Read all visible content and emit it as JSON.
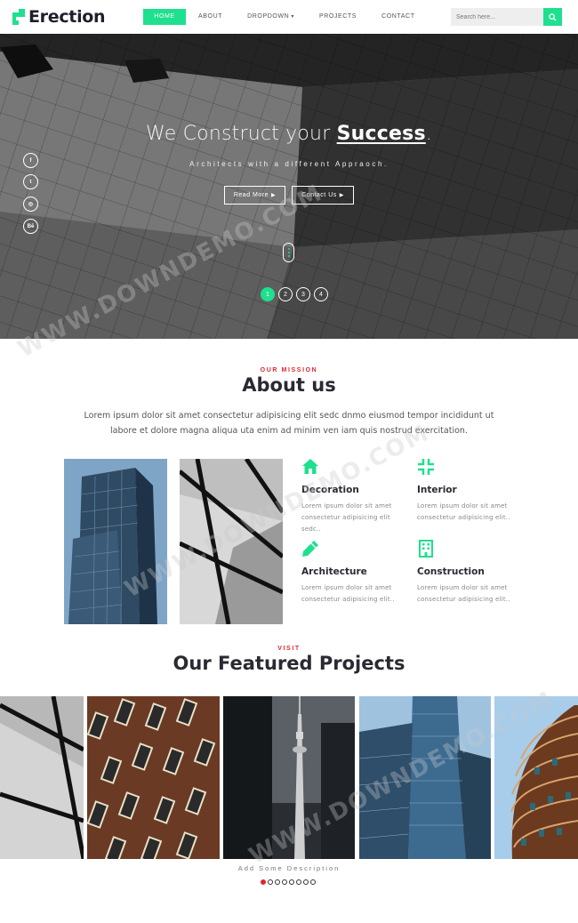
{
  "brand": {
    "name": "Erection",
    "accent": "#1ee08f"
  },
  "nav": {
    "items": [
      {
        "label": "HOME",
        "active": true
      },
      {
        "label": "ABOUT",
        "active": false
      },
      {
        "label": "DROPDOWN",
        "active": false
      },
      {
        "label": "PROJECTS",
        "active": false
      },
      {
        "label": "CONTACT",
        "active": false
      }
    ],
    "search_placeholder": "Search here..."
  },
  "hero": {
    "title_prefix": "We Construct your ",
    "title_emphasis": "Success",
    "title_suffix": ".",
    "subtitle": "Architects with a different Appraoch.",
    "read_more": "Read More",
    "contact_us": "Contact Us",
    "social": [
      "f",
      "t",
      "◎",
      "Bē"
    ],
    "slides": [
      "1",
      "2",
      "3",
      "4"
    ],
    "active_slide": 1
  },
  "about": {
    "kicker": "OUR MISSION",
    "title": "About us",
    "text": "Lorem ipsum dolor sit amet consectetur adipisicing elit sedc dnmo eiusmod tempor incididunt ut labore et dolore magna aliqua uta enim ad minim ven iam quis nostrud exercitation.",
    "features": [
      {
        "icon": "home-icon",
        "title": "Decoration",
        "text": "Lorem ipsum dolor sit amet consectetur adipisicing elit sedc.."
      },
      {
        "icon": "compress-icon",
        "title": "Interior",
        "text": "Lorem ipsum dolor sit amet consectetur adipisicing elit.."
      },
      {
        "icon": "pencil-icon",
        "title": "Architecture",
        "text": "Lorem ipsum dolor sit amet consectetur adipisicing elit.."
      },
      {
        "icon": "building-icon",
        "title": "Construction",
        "text": "Lorem ipsum dolor sit amet consectetur adipisicing elit.."
      }
    ]
  },
  "projects": {
    "kicker": "VISIT",
    "title": "Our Featured Projects",
    "description": "Add Some Description",
    "dot_count": 8,
    "active_dot": 1
  },
  "watermark": "WWW.DOWNDEMO.COM"
}
